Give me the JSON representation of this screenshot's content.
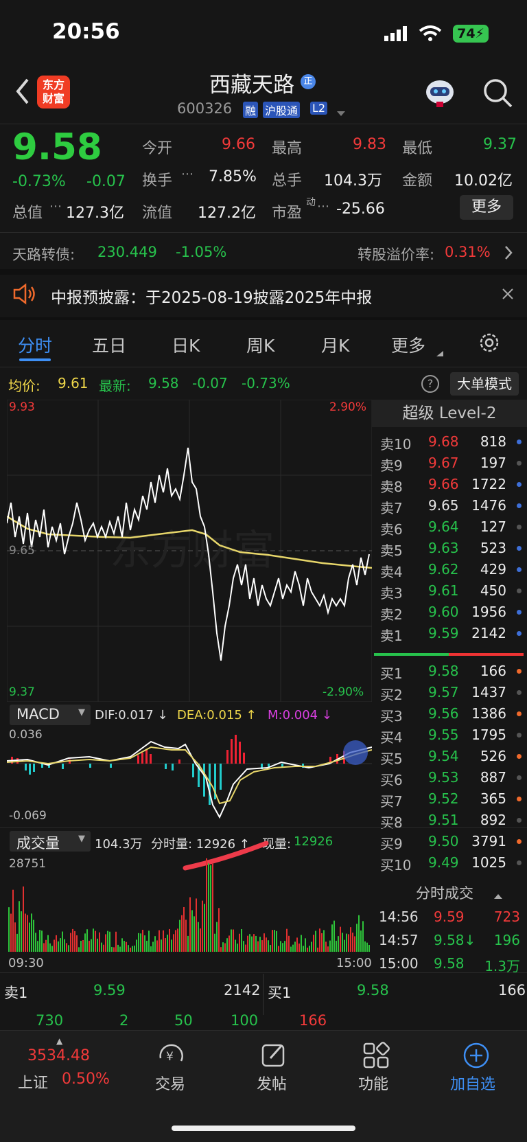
{
  "status": {
    "time": "20:56",
    "battery": "74"
  },
  "header": {
    "name": "西藏天路",
    "code": "600326",
    "tags": [
      "融",
      "沪股通",
      "L2"
    ]
  },
  "quote": {
    "price": "9.58",
    "pct": "-0.73%",
    "chg": "-0.07",
    "open_label": "今开",
    "open": "9.66",
    "high_label": "最高",
    "high": "9.83",
    "low_label": "最低",
    "low": "9.37",
    "turn_label": "换手",
    "turn": "7.85%",
    "vol_label": "总手",
    "vol": "104.3万",
    "amt_label": "金额",
    "amt": "10.02亿",
    "mcap_label": "总值",
    "mcap": "127.3亿",
    "float_label": "流值",
    "float": "127.2亿",
    "pe_label": "市盈",
    "pe_sup": "动",
    "pe": "-25.66",
    "more": "更多"
  },
  "bond": {
    "label": "天路转债:",
    "price": "230.449",
    "pct": "-1.05%",
    "prem_label": "转股溢价率:",
    "prem": "0.31%"
  },
  "notice": {
    "text": "中报预披露：于2025-08-19披露2025年中报"
  },
  "tabs": [
    "分时",
    "五日",
    "日K",
    "周K",
    "月K",
    "更多"
  ],
  "avgline": {
    "avg_label": "均价:",
    "avg": "9.61",
    "new_label": "最新:",
    "new": "9.58",
    "chg": "-0.07",
    "pct": "-0.73%",
    "mode": "大单模式"
  },
  "chart": {
    "ymax": "9.93",
    "ymin": "9.37",
    "pmax": "2.90%",
    "pmin": "-2.90%",
    "mid": "9.65",
    "t0": "09:30",
    "t1": "15:00"
  },
  "macd": {
    "name": "MACD",
    "dif": "DIF:0.017 ↓",
    "dea": "DEA:0.015 ↑",
    "m": "M:0.004 ↓",
    "top": "0.036",
    "bot": "-0.069"
  },
  "volume": {
    "name": "成交量",
    "total": "104.3万",
    "fen": "分时量: 12926 ↑",
    "now_label": "现量:",
    "now": "12926",
    "max": "28751"
  },
  "level2": {
    "title": "超级 Level-2",
    "asks": [
      [
        "卖10",
        "9.68",
        "818"
      ],
      [
        "卖9",
        "9.67",
        "197"
      ],
      [
        "卖8",
        "9.66",
        "1722"
      ],
      [
        "卖7",
        "9.65",
        "1476"
      ],
      [
        "卖6",
        "9.64",
        "127"
      ],
      [
        "卖5",
        "9.63",
        "523"
      ],
      [
        "卖4",
        "9.62",
        "429"
      ],
      [
        "卖3",
        "9.61",
        "450"
      ],
      [
        "卖2",
        "9.60",
        "1956"
      ],
      [
        "卖1",
        "9.59",
        "2142"
      ]
    ],
    "bids": [
      [
        "买1",
        "9.58",
        "166"
      ],
      [
        "买2",
        "9.57",
        "1437"
      ],
      [
        "买3",
        "9.56",
        "1386"
      ],
      [
        "买4",
        "9.55",
        "1795"
      ],
      [
        "买5",
        "9.54",
        "526"
      ],
      [
        "买6",
        "9.53",
        "887"
      ],
      [
        "买7",
        "9.52",
        "365"
      ],
      [
        "买8",
        "9.51",
        "892"
      ],
      [
        "买9",
        "9.50",
        "3791"
      ],
      [
        "买10",
        "9.49",
        "1025"
      ]
    ],
    "ticks_title": "分时成交",
    "ticks": [
      [
        "14:56",
        "9.59",
        "723"
      ],
      [
        "14:57",
        "9.58↓",
        "196"
      ],
      [
        "15:00",
        "9.58",
        "1.3万"
      ]
    ]
  },
  "bottom": {
    "sell_label": "卖1",
    "sell_price": "9.59",
    "sell_vol": "2142",
    "buy_label": "买1",
    "buy_price": "9.58",
    "buy_vol": "166",
    "nums": [
      "730",
      "2",
      "50",
      "100"
    ],
    "bnum": "166"
  },
  "nav": {
    "index": "3534.48",
    "index_name": "上证",
    "index_pct": "0.50%",
    "items": [
      "交易",
      "发帖",
      "功能",
      "加自选"
    ]
  }
}
